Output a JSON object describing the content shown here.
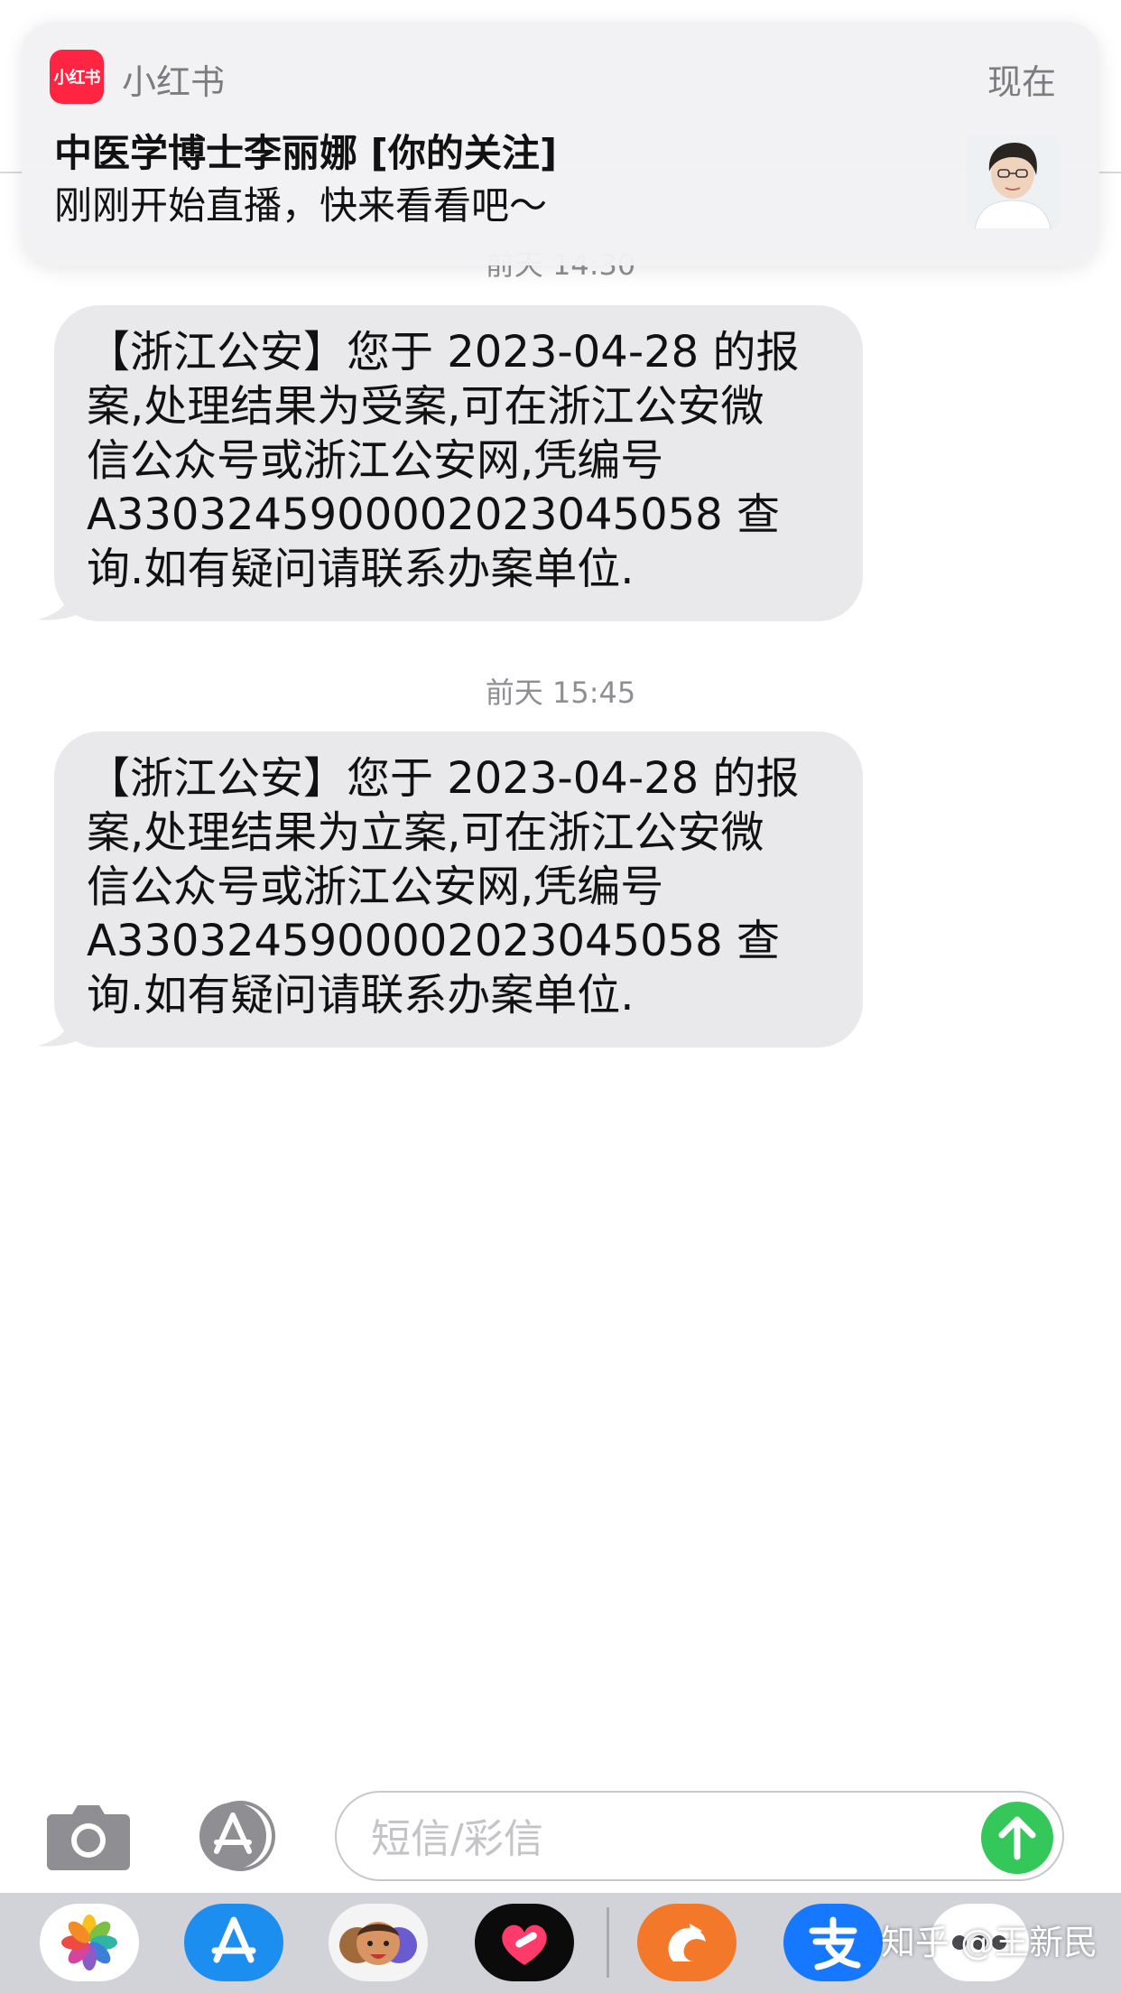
{
  "notification": {
    "app_name": "小红书",
    "app_icon_text": "小红书",
    "time": "现在",
    "title": "中医学博士李丽娜 [你的关注]",
    "body": "刚刚开始直播，快来看看吧～"
  },
  "thread": {
    "timestamp_1": "前天 14:30",
    "message_1": "【浙江公安】您于 2023-04-28 的报案,处理结果为受案,可在浙江公安微信公众号或浙江公安网,凭编号A330324590000202304 5058 查询.如有疑问请联系办案单位.",
    "message_1_lines": [
      "【浙江公安】您于 2023-04-28 的报",
      "案,处理结果为受案,可在浙江公安微",
      "信公众号或浙江公安网,凭编号",
      "A3303245900002023045058 查",
      "询.如有疑问请联系办案单位."
    ],
    "timestamp_2": "前天 15:45",
    "message_2_lines": [
      "【浙江公安】您于 2023-04-28 的报",
      "案,处理结果为立案,可在浙江公安微",
      "信公众号或浙江公安网,凭编号",
      "A3303245900002023045058 查",
      "询.如有疑问请联系办案单位."
    ]
  },
  "input_bar": {
    "placeholder": "短信/彩信"
  },
  "app_drawer": {
    "apps": [
      "photos-icon",
      "app-store-icon",
      "memoji-icon",
      "heart-app-icon",
      "orange-app-icon",
      "alipay-icon",
      "more-icon"
    ]
  },
  "watermark": "知乎 @王新民",
  "colors": {
    "bubble": "#e9e9eb",
    "send": "#34c759",
    "xhs_red": "#ff2442",
    "drawer": "#d1d3d9"
  }
}
